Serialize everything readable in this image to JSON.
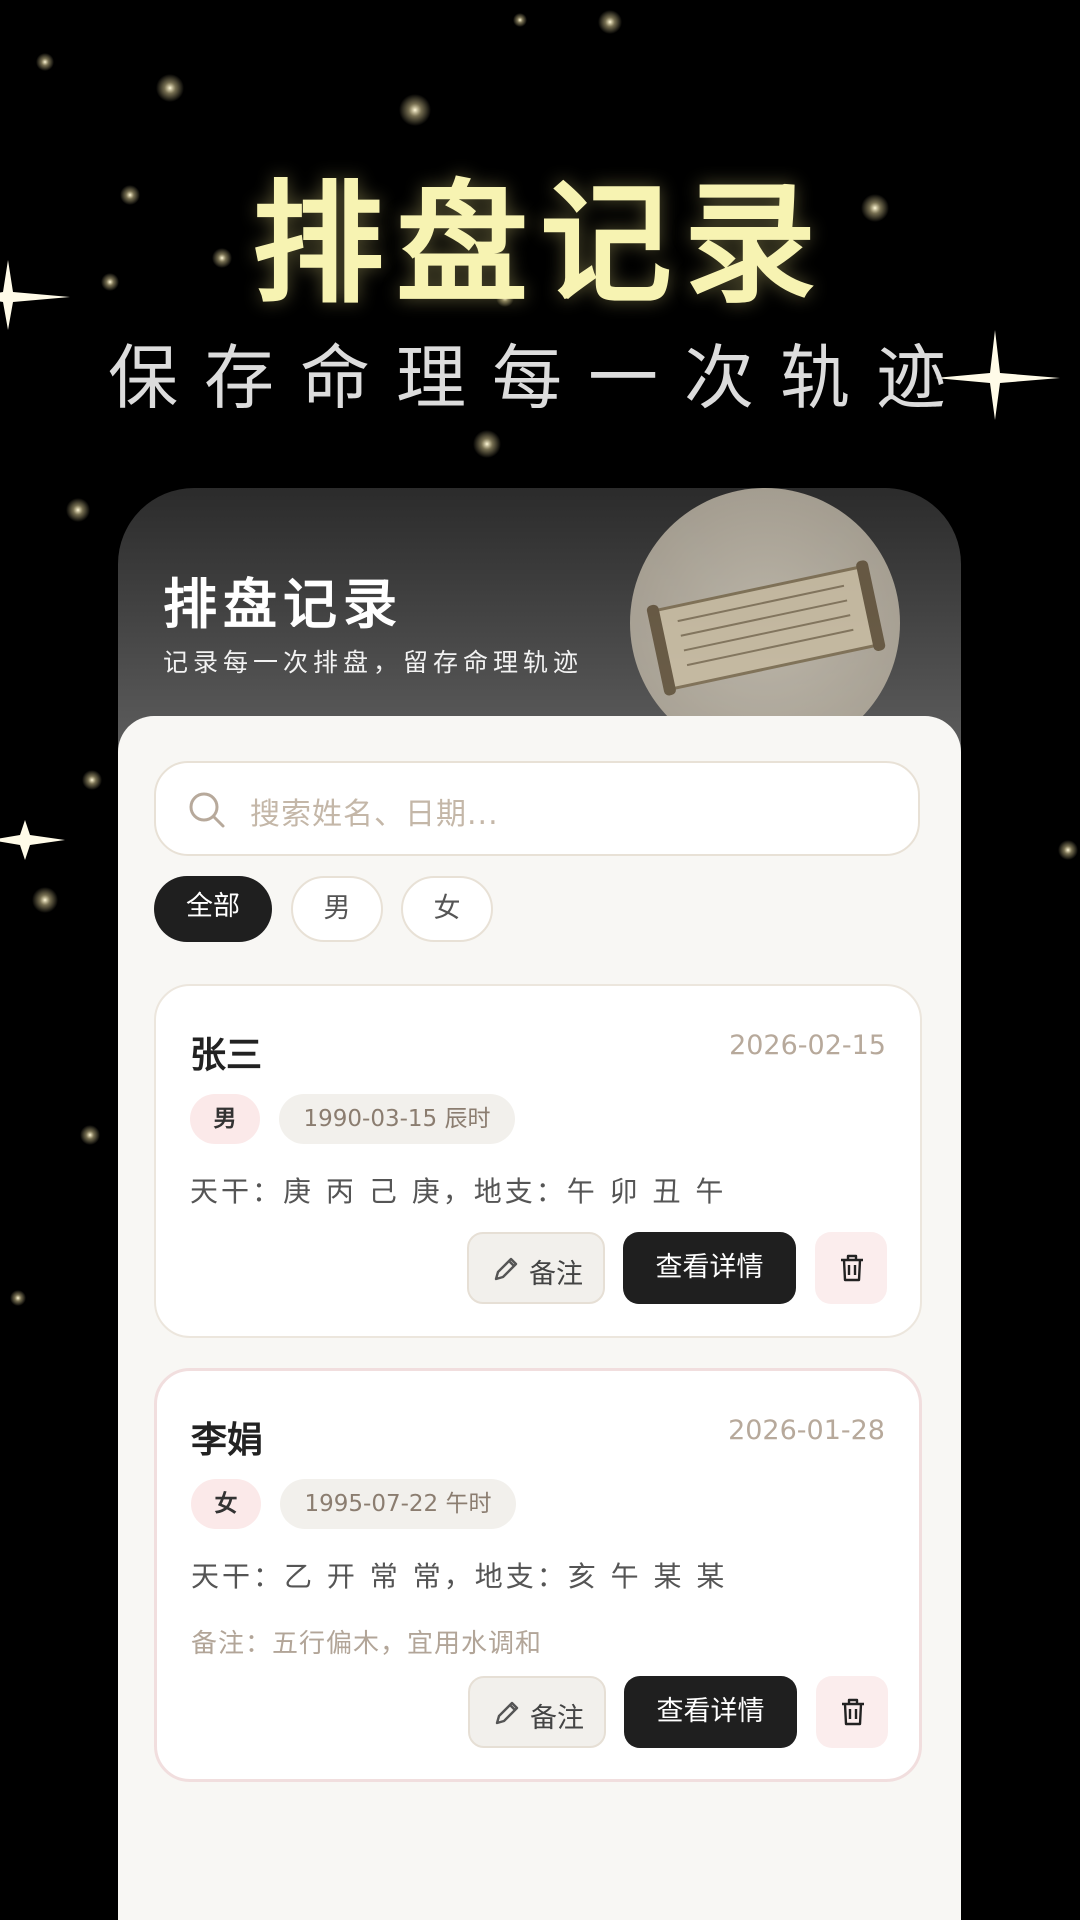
{
  "hero": {
    "title": "排盘记录",
    "subtitle": "保存命理每一次轨迹"
  },
  "header": {
    "title": "排盘记录",
    "subtitle": "记录每一次排盘，留存命理轨迹"
  },
  "search": {
    "placeholder": "搜索姓名、日期..."
  },
  "filters": [
    {
      "label": "全部",
      "active": true
    },
    {
      "label": "男",
      "active": false
    },
    {
      "label": "女",
      "active": false
    }
  ],
  "records": [
    {
      "name": "张三",
      "date": "2026-02-15",
      "gender": "男",
      "birth": "1990-03-15 辰时",
      "ganzhi": "天干：庚 丙 己 庚，地支：午 卯 丑 午",
      "note": "",
      "note_button": "备注",
      "detail_button": "查看详情"
    },
    {
      "name": "李娟",
      "date": "2026-01-28",
      "gender": "女",
      "birth": "1995-07-22 午时",
      "ganzhi": "天干：乙 开 常 常，地支：亥 午 某 某",
      "note": "备注：五行偏木，宜用水调和",
      "note_button": "备注",
      "detail_button": "查看详情"
    }
  ],
  "colors": {
    "hero_title": "#f7f3b2",
    "active_filter_bg": "#1f1f1f",
    "delete_bg": "#fbeded"
  }
}
